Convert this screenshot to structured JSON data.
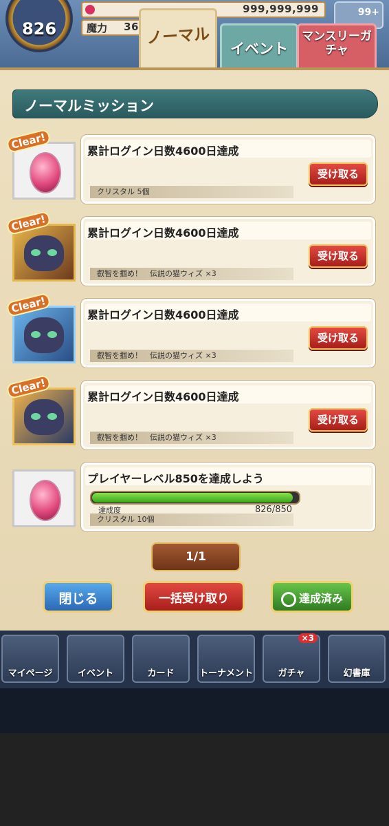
{
  "status": {
    "level": "826",
    "gold": "999,999,999",
    "magic_label": "魔力",
    "magic_value": "36",
    "gift_count": "99+"
  },
  "tabs": [
    {
      "label": "ノーマル"
    },
    {
      "label": "イベント"
    },
    {
      "label": "マンスリーガチャ"
    }
  ],
  "panel": {
    "title": "ノーマルミッション"
  },
  "missions": [
    {
      "clear": "Clear!",
      "title": "累計ログイン日数4600日達成",
      "button": "受け取る",
      "reward": "クリスタル 5個"
    },
    {
      "clear": "Clear!",
      "title": "累計ログイン日数4600日達成",
      "button": "受け取る",
      "reward": "叡智を掴め！　伝説の猫ウィズ ×3"
    },
    {
      "clear": "Clear!",
      "title": "累計ログイン日数4600日達成",
      "button": "受け取る",
      "reward": "叡智を掴め！　伝説の猫ウィズ ×3"
    },
    {
      "clear": "Clear!",
      "title": "累計ログイン日数4600日達成",
      "button": "受け取る",
      "reward": "叡智を掴め！　伝説の猫ウィズ ×3"
    },
    {
      "title": "プレイヤーレベル850を達成しよう",
      "progress_label": "達成度",
      "progress_text": "826/850",
      "progress_value": 826,
      "progress_max": 850,
      "reward": "クリスタル 10個"
    }
  ],
  "pager": "1/1",
  "buttons": {
    "close": "閉じる",
    "bulk": "一括受け取り",
    "done": "達成済み"
  },
  "nav": [
    {
      "label": "マイページ"
    },
    {
      "label": "イベント"
    },
    {
      "label": "カード"
    },
    {
      "label": "トーナメント"
    },
    {
      "label": "ガチャ",
      "badge": "×3"
    },
    {
      "label": "幻書庫"
    }
  ],
  "colors": {
    "accent_red": "#c42a24",
    "accent_blue": "#3a80cc",
    "accent_green": "#3e9a2e",
    "panel_header": "#2f6366"
  }
}
